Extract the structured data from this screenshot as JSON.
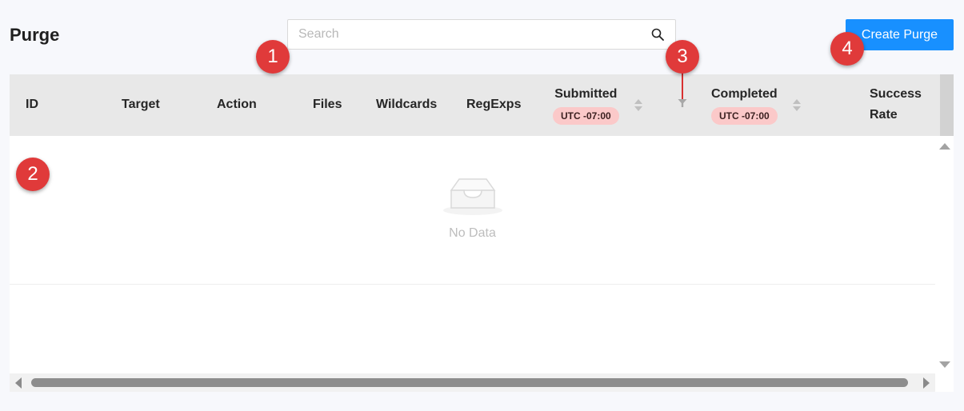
{
  "page": {
    "title": "Purge"
  },
  "search": {
    "placeholder": "Search",
    "value": ""
  },
  "toolbar": {
    "create_label": "Create Purge"
  },
  "table": {
    "columns": {
      "id": "ID",
      "target": "Target",
      "action": "Action",
      "files": "Files",
      "wildcards": "Wildcards",
      "regexps": "RegExps",
      "submitted": "Submitted",
      "submitted_tz": "UTC -07:00",
      "completed": "Completed",
      "completed_tz": "UTC -07:00",
      "success_line1": "Success",
      "success_line2": "Rate"
    },
    "rows": [],
    "empty_text": "No Data"
  },
  "callouts": [
    "1",
    "2",
    "3",
    "4"
  ],
  "colors": {
    "accent": "#1890ff",
    "callout": "#e03a3a",
    "timezone_badge": "#fbc9c9",
    "header_bg": "#e8e8e8"
  },
  "icons": {
    "search": "search-icon",
    "filter": "filter-icon",
    "empty": "empty-inbox-icon"
  }
}
